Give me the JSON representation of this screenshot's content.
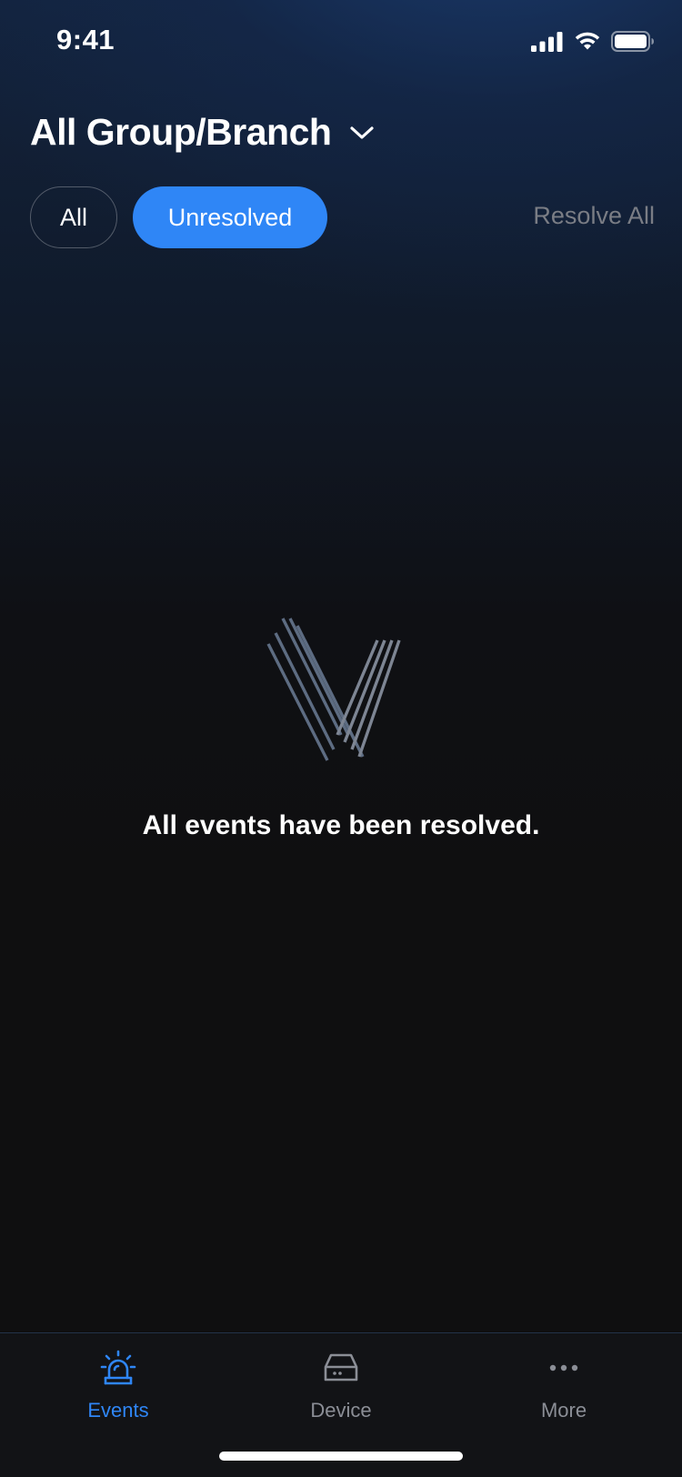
{
  "status_bar": {
    "time": "9:41"
  },
  "header": {
    "title": "All Group/Branch"
  },
  "filters": {
    "all_label": "All",
    "unresolved_label": "Unresolved",
    "selected": "Unresolved",
    "resolve_all_label": "Resolve All"
  },
  "empty_state": {
    "message": "All events have been resolved."
  },
  "tab_bar": {
    "active": "Events",
    "tabs": [
      {
        "label": "Events",
        "icon": "siren-icon"
      },
      {
        "label": "Device",
        "icon": "device-icon"
      },
      {
        "label": "More",
        "icon": "more-dots-icon"
      }
    ]
  },
  "colors": {
    "accent": "#2f86f6",
    "background": "#0f0f10",
    "inactive_text": "#8b8e96",
    "muted_action": "#7a7d85"
  }
}
